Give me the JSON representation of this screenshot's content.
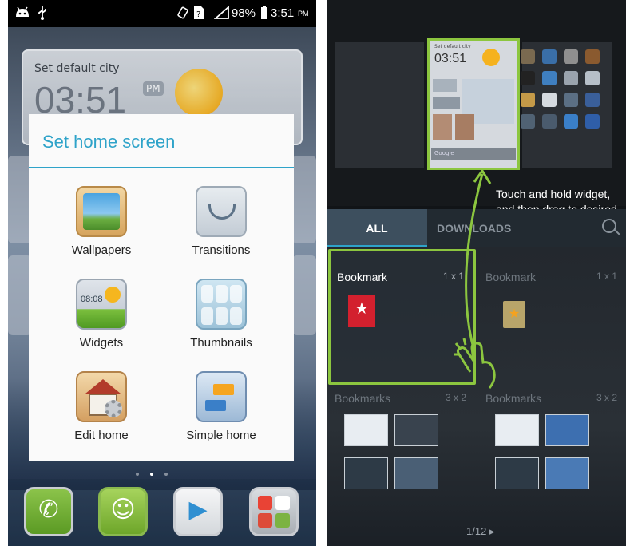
{
  "status_bar": {
    "battery": "98%",
    "time": "3:51",
    "ampm": "PM"
  },
  "clock_widget": {
    "city": "Set default city",
    "time": "03:51",
    "ampm": "PM"
  },
  "dialog": {
    "title": "Set home screen",
    "options": [
      {
        "label": "Wallpapers",
        "icon": "wallpaper-icon"
      },
      {
        "label": "Transitions",
        "icon": "transitions-icon"
      },
      {
        "label": "Widgets",
        "icon": "widgets-icon"
      },
      {
        "label": "Thumbnails",
        "icon": "thumbnails-icon"
      },
      {
        "label": "Edit home",
        "icon": "edit-home-icon"
      },
      {
        "label": "Simple home",
        "icon": "simple-home-icon"
      }
    ],
    "widget_clock_text": "08:08",
    "accent_color": "#2ea3c9"
  },
  "dock": [
    {
      "name": "phone-app",
      "icon": "phone-icon"
    },
    {
      "name": "messaging-app",
      "icon": "message-icon"
    },
    {
      "name": "play-store-app",
      "icon": "play-store-icon"
    },
    {
      "name": "apps-folder",
      "icon": "folder-icon"
    }
  ],
  "right": {
    "preview": {
      "city": "Set default city",
      "time": "03:51",
      "search": "Google"
    },
    "tip": "Touch and hold widget, and then drag to desired screen",
    "tabs": {
      "all": "ALL",
      "downloads": "DOWNLOADS"
    },
    "cards": [
      {
        "name": "Bookmark",
        "size": "1 x 1"
      },
      {
        "name": "Bookmark",
        "size": "1 x 1"
      },
      {
        "name": "Bookmarks",
        "size": "3 x 2"
      },
      {
        "name": "Bookmarks",
        "size": "3 x 2"
      }
    ],
    "pager": "1/12",
    "highlight_color": "#8cc63f"
  }
}
